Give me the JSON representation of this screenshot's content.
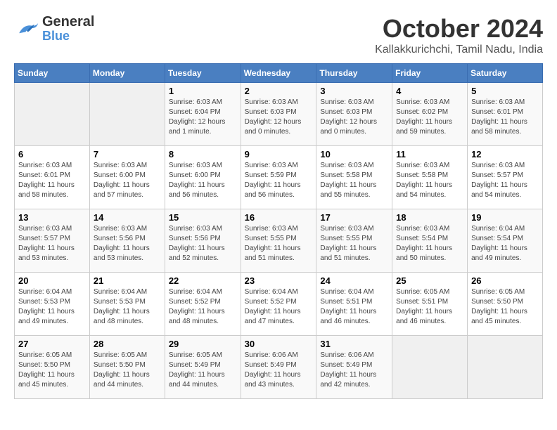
{
  "header": {
    "logo_general": "General",
    "logo_blue": "Blue",
    "month_title": "October 2024",
    "location": "Kallakkurichchi, Tamil Nadu, India"
  },
  "calendar": {
    "weekdays": [
      "Sunday",
      "Monday",
      "Tuesday",
      "Wednesday",
      "Thursday",
      "Friday",
      "Saturday"
    ],
    "weeks": [
      [
        {
          "day": "",
          "info": ""
        },
        {
          "day": "",
          "info": ""
        },
        {
          "day": "1",
          "info": "Sunrise: 6:03 AM\nSunset: 6:04 PM\nDaylight: 12 hours\nand 1 minute."
        },
        {
          "day": "2",
          "info": "Sunrise: 6:03 AM\nSunset: 6:03 PM\nDaylight: 12 hours\nand 0 minutes."
        },
        {
          "day": "3",
          "info": "Sunrise: 6:03 AM\nSunset: 6:03 PM\nDaylight: 12 hours\nand 0 minutes."
        },
        {
          "day": "4",
          "info": "Sunrise: 6:03 AM\nSunset: 6:02 PM\nDaylight: 11 hours\nand 59 minutes."
        },
        {
          "day": "5",
          "info": "Sunrise: 6:03 AM\nSunset: 6:01 PM\nDaylight: 11 hours\nand 58 minutes."
        }
      ],
      [
        {
          "day": "6",
          "info": "Sunrise: 6:03 AM\nSunset: 6:01 PM\nDaylight: 11 hours\nand 58 minutes."
        },
        {
          "day": "7",
          "info": "Sunrise: 6:03 AM\nSunset: 6:00 PM\nDaylight: 11 hours\nand 57 minutes."
        },
        {
          "day": "8",
          "info": "Sunrise: 6:03 AM\nSunset: 6:00 PM\nDaylight: 11 hours\nand 56 minutes."
        },
        {
          "day": "9",
          "info": "Sunrise: 6:03 AM\nSunset: 5:59 PM\nDaylight: 11 hours\nand 56 minutes."
        },
        {
          "day": "10",
          "info": "Sunrise: 6:03 AM\nSunset: 5:58 PM\nDaylight: 11 hours\nand 55 minutes."
        },
        {
          "day": "11",
          "info": "Sunrise: 6:03 AM\nSunset: 5:58 PM\nDaylight: 11 hours\nand 54 minutes."
        },
        {
          "day": "12",
          "info": "Sunrise: 6:03 AM\nSunset: 5:57 PM\nDaylight: 11 hours\nand 54 minutes."
        }
      ],
      [
        {
          "day": "13",
          "info": "Sunrise: 6:03 AM\nSunset: 5:57 PM\nDaylight: 11 hours\nand 53 minutes."
        },
        {
          "day": "14",
          "info": "Sunrise: 6:03 AM\nSunset: 5:56 PM\nDaylight: 11 hours\nand 53 minutes."
        },
        {
          "day": "15",
          "info": "Sunrise: 6:03 AM\nSunset: 5:56 PM\nDaylight: 11 hours\nand 52 minutes."
        },
        {
          "day": "16",
          "info": "Sunrise: 6:03 AM\nSunset: 5:55 PM\nDaylight: 11 hours\nand 51 minutes."
        },
        {
          "day": "17",
          "info": "Sunrise: 6:03 AM\nSunset: 5:55 PM\nDaylight: 11 hours\nand 51 minutes."
        },
        {
          "day": "18",
          "info": "Sunrise: 6:03 AM\nSunset: 5:54 PM\nDaylight: 11 hours\nand 50 minutes."
        },
        {
          "day": "19",
          "info": "Sunrise: 6:04 AM\nSunset: 5:54 PM\nDaylight: 11 hours\nand 49 minutes."
        }
      ],
      [
        {
          "day": "20",
          "info": "Sunrise: 6:04 AM\nSunset: 5:53 PM\nDaylight: 11 hours\nand 49 minutes."
        },
        {
          "day": "21",
          "info": "Sunrise: 6:04 AM\nSunset: 5:53 PM\nDaylight: 11 hours\nand 48 minutes."
        },
        {
          "day": "22",
          "info": "Sunrise: 6:04 AM\nSunset: 5:52 PM\nDaylight: 11 hours\nand 48 minutes."
        },
        {
          "day": "23",
          "info": "Sunrise: 6:04 AM\nSunset: 5:52 PM\nDaylight: 11 hours\nand 47 minutes."
        },
        {
          "day": "24",
          "info": "Sunrise: 6:04 AM\nSunset: 5:51 PM\nDaylight: 11 hours\nand 46 minutes."
        },
        {
          "day": "25",
          "info": "Sunrise: 6:05 AM\nSunset: 5:51 PM\nDaylight: 11 hours\nand 46 minutes."
        },
        {
          "day": "26",
          "info": "Sunrise: 6:05 AM\nSunset: 5:50 PM\nDaylight: 11 hours\nand 45 minutes."
        }
      ],
      [
        {
          "day": "27",
          "info": "Sunrise: 6:05 AM\nSunset: 5:50 PM\nDaylight: 11 hours\nand 45 minutes."
        },
        {
          "day": "28",
          "info": "Sunrise: 6:05 AM\nSunset: 5:50 PM\nDaylight: 11 hours\nand 44 minutes."
        },
        {
          "day": "29",
          "info": "Sunrise: 6:05 AM\nSunset: 5:49 PM\nDaylight: 11 hours\nand 44 minutes."
        },
        {
          "day": "30",
          "info": "Sunrise: 6:06 AM\nSunset: 5:49 PM\nDaylight: 11 hours\nand 43 minutes."
        },
        {
          "day": "31",
          "info": "Sunrise: 6:06 AM\nSunset: 5:49 PM\nDaylight: 11 hours\nand 42 minutes."
        },
        {
          "day": "",
          "info": ""
        },
        {
          "day": "",
          "info": ""
        }
      ]
    ]
  }
}
